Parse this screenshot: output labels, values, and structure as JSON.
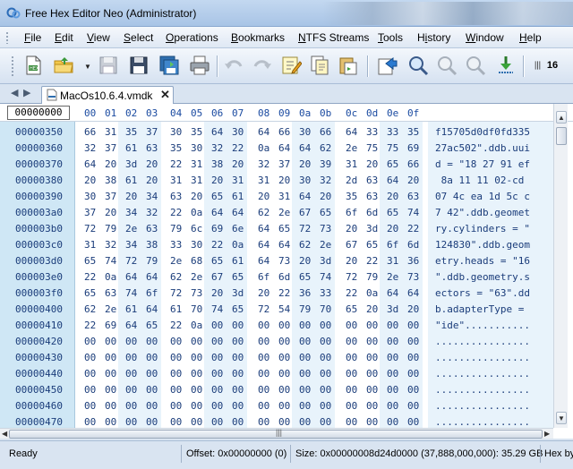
{
  "window": {
    "title": "Free Hex Editor Neo (Administrator)"
  },
  "menu": [
    "File",
    "Edit",
    "View",
    "Select",
    "Operations",
    "Bookmarks",
    "NTFS Streams",
    "Tools",
    "History",
    "Window",
    "Help"
  ],
  "menu_accel": [
    "F",
    "E",
    "V",
    "S",
    "O",
    "B",
    "N",
    "T",
    "i",
    "W",
    "H"
  ],
  "toolbar": {
    "items": [
      "new-file-icon",
      "open-folder-icon",
      "save-icon",
      "save-as-icon",
      "save-all-icon",
      "print-icon",
      "undo-icon",
      "redo-icon",
      "edit-icon",
      "copy-icon",
      "paste-icon",
      "export-icon",
      "go-to-icon",
      "find-icon",
      "find-next-icon",
      "find-replace-icon",
      "bookmark-icon",
      "column-count-icon"
    ],
    "column_count": "16"
  },
  "tab": {
    "label": "MacOs10.6.4.vmdk",
    "close": "✕"
  },
  "editor": {
    "header_offset": "00000000",
    "columns": [
      "00",
      "01",
      "02",
      "03",
      "04",
      "05",
      "06",
      "07",
      "08",
      "09",
      "0a",
      "0b",
      "0c",
      "0d",
      "0e",
      "0f"
    ],
    "rows": [
      {
        "offset": "00000350",
        "bytes": [
          "66",
          "31",
          "35",
          "37",
          "30",
          "35",
          "64",
          "30",
          "64",
          "66",
          "30",
          "66",
          "64",
          "33",
          "33",
          "35"
        ],
        "text": "f15705d0df0fd335"
      },
      {
        "offset": "00000360",
        "bytes": [
          "32",
          "37",
          "61",
          "63",
          "35",
          "30",
          "32",
          "22",
          "0a",
          "64",
          "64",
          "62",
          "2e",
          "75",
          "75",
          "69"
        ],
        "text": "27ac502\".ddb.uui"
      },
      {
        "offset": "00000370",
        "bytes": [
          "64",
          "20",
          "3d",
          "20",
          "22",
          "31",
          "38",
          "20",
          "32",
          "37",
          "20",
          "39",
          "31",
          "20",
          "65",
          "66"
        ],
        "text": "d = \"18 27 91 ef"
      },
      {
        "offset": "00000380",
        "bytes": [
          "20",
          "38",
          "61",
          "20",
          "31",
          "31",
          "20",
          "31",
          "31",
          "20",
          "30",
          "32",
          "2d",
          "63",
          "64",
          "20"
        ],
        "text": " 8a 11 11 02-cd "
      },
      {
        "offset": "00000390",
        "bytes": [
          "30",
          "37",
          "20",
          "34",
          "63",
          "20",
          "65",
          "61",
          "20",
          "31",
          "64",
          "20",
          "35",
          "63",
          "20",
          "63"
        ],
        "text": "07 4c ea 1d 5c c"
      },
      {
        "offset": "000003a0",
        "bytes": [
          "37",
          "20",
          "34",
          "32",
          "22",
          "0a",
          "64",
          "64",
          "62",
          "2e",
          "67",
          "65",
          "6f",
          "6d",
          "65",
          "74"
        ],
        "text": "7 42\".ddb.geomet"
      },
      {
        "offset": "000003b0",
        "bytes": [
          "72",
          "79",
          "2e",
          "63",
          "79",
          "6c",
          "69",
          "6e",
          "64",
          "65",
          "72",
          "73",
          "20",
          "3d",
          "20",
          "22"
        ],
        "text": "ry.cylinders = \""
      },
      {
        "offset": "000003c0",
        "bytes": [
          "31",
          "32",
          "34",
          "38",
          "33",
          "30",
          "22",
          "0a",
          "64",
          "64",
          "62",
          "2e",
          "67",
          "65",
          "6f",
          "6d"
        ],
        "text": "124830\".ddb.geom"
      },
      {
        "offset": "000003d0",
        "bytes": [
          "65",
          "74",
          "72",
          "79",
          "2e",
          "68",
          "65",
          "61",
          "64",
          "73",
          "20",
          "3d",
          "20",
          "22",
          "31",
          "36"
        ],
        "text": "etry.heads = \"16"
      },
      {
        "offset": "000003e0",
        "bytes": [
          "22",
          "0a",
          "64",
          "64",
          "62",
          "2e",
          "67",
          "65",
          "6f",
          "6d",
          "65",
          "74",
          "72",
          "79",
          "2e",
          "73"
        ],
        "text": "\".ddb.geometry.s"
      },
      {
        "offset": "000003f0",
        "bytes": [
          "65",
          "63",
          "74",
          "6f",
          "72",
          "73",
          "20",
          "3d",
          "20",
          "22",
          "36",
          "33",
          "22",
          "0a",
          "64",
          "64"
        ],
        "text": "ectors = \"63\".dd"
      },
      {
        "offset": "00000400",
        "bytes": [
          "62",
          "2e",
          "61",
          "64",
          "61",
          "70",
          "74",
          "65",
          "72",
          "54",
          "79",
          "70",
          "65",
          "20",
          "3d",
          "20"
        ],
        "text": "b.adapterType = "
      },
      {
        "offset": "00000410",
        "bytes": [
          "22",
          "69",
          "64",
          "65",
          "22",
          "0a",
          "00",
          "00",
          "00",
          "00",
          "00",
          "00",
          "00",
          "00",
          "00",
          "00"
        ],
        "text": "\"ide\"..........."
      },
      {
        "offset": "00000420",
        "bytes": [
          "00",
          "00",
          "00",
          "00",
          "00",
          "00",
          "00",
          "00",
          "00",
          "00",
          "00",
          "00",
          "00",
          "00",
          "00",
          "00"
        ],
        "text": "................"
      },
      {
        "offset": "00000430",
        "bytes": [
          "00",
          "00",
          "00",
          "00",
          "00",
          "00",
          "00",
          "00",
          "00",
          "00",
          "00",
          "00",
          "00",
          "00",
          "00",
          "00"
        ],
        "text": "................"
      },
      {
        "offset": "00000440",
        "bytes": [
          "00",
          "00",
          "00",
          "00",
          "00",
          "00",
          "00",
          "00",
          "00",
          "00",
          "00",
          "00",
          "00",
          "00",
          "00",
          "00"
        ],
        "text": "................"
      },
      {
        "offset": "00000450",
        "bytes": [
          "00",
          "00",
          "00",
          "00",
          "00",
          "00",
          "00",
          "00",
          "00",
          "00",
          "00",
          "00",
          "00",
          "00",
          "00",
          "00"
        ],
        "text": "................"
      },
      {
        "offset": "00000460",
        "bytes": [
          "00",
          "00",
          "00",
          "00",
          "00",
          "00",
          "00",
          "00",
          "00",
          "00",
          "00",
          "00",
          "00",
          "00",
          "00",
          "00"
        ],
        "text": "................"
      },
      {
        "offset": "00000470",
        "bytes": [
          "00",
          "00",
          "00",
          "00",
          "00",
          "00",
          "00",
          "00",
          "00",
          "00",
          "00",
          "00",
          "00",
          "00",
          "00",
          "00"
        ],
        "text": "................"
      }
    ]
  },
  "status": {
    "ready": "Ready",
    "offset": "Offset: 0x00000000 (0)",
    "size": "Size: 0x00000008d24d0000 (37,888,000,000): 35.29 GB",
    "mode": "Hex by"
  },
  "colors": {
    "offset_bg": "#cfe7f5",
    "text_bg": "#e8f3fb",
    "hex_text": "#1a3c7a",
    "header_text": "#1a4aa0"
  }
}
